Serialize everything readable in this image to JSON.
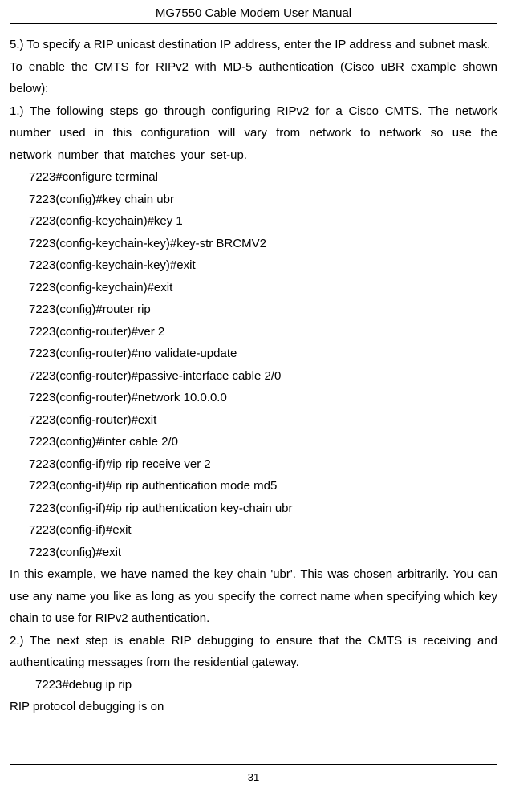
{
  "header": {
    "title": "MG7550 Cable Modem User Manual"
  },
  "body": {
    "p1": "5.) To specify a RIP unicast destination IP address, enter the IP address and subnet mask.",
    "p2": "To enable the CMTS for RIPv2 with MD-5 authentication (Cisco uBR example shown below):",
    "p3": "1.) The following steps go through configuring RIPv2 for a Cisco CMTS. The network number used in this configuration will vary from network to network so use the network number that matches your set-up.",
    "config1": [
      "7223#configure terminal",
      "7223(config)#key chain ubr",
      "7223(config-keychain)#key 1",
      "7223(config-keychain-key)#key-str BRCMV2",
      "7223(config-keychain-key)#exit",
      "7223(config-keychain)#exit",
      "7223(config)#router rip",
      "7223(config-router)#ver 2",
      "7223(config-router)#no validate-update",
      "7223(config-router)#passive-interface cable 2/0",
      "7223(config-router)#network 10.0.0.0",
      "7223(config-router)#exit",
      "7223(config)#inter cable 2/0",
      "7223(config-if)#ip rip receive ver 2",
      "7223(config-if)#ip rip authentication mode md5",
      "7223(config-if)#ip rip authentication key-chain ubr",
      "7223(config-if)#exit",
      "7223(config)#exit"
    ],
    "p4": "In this example, we have named the key chain 'ubr'. This was chosen arbitrarily. You can use any name you like as long as you specify the correct name when specifying which key chain to use for RIPv2 authentication.",
    "p5": "2.) The next step is enable RIP debugging to ensure that the CMTS is receiving and authenticating messages from the residential gateway.",
    "config2": [
      "7223#debug ip rip"
    ],
    "p6": "RIP protocol debugging is on"
  },
  "footer": {
    "page_number": "31"
  }
}
